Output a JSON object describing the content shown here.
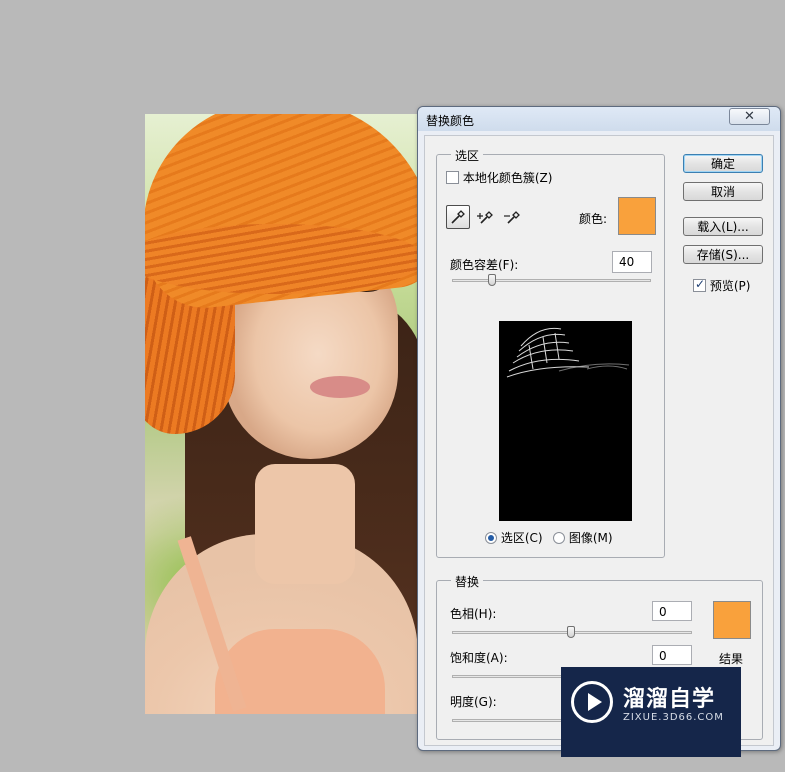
{
  "dialog": {
    "title": "替换颜色",
    "close_symbol": "✕",
    "selection_group": {
      "label": "选区",
      "localized_color_clusters": "本地化颜色簇(Z)",
      "localized_color_clusters_checked": false,
      "color_label": "颜色:",
      "selected_color": "#f9a13c",
      "fuzziness_label": "颜色容差(F):",
      "fuzziness_value": "40",
      "fuzziness_level": 0.2,
      "view_selection": "选区(C)",
      "view_image": "图像(M)",
      "view_mode": "selection"
    },
    "buttons": {
      "ok": "确定",
      "cancel": "取消",
      "load": "载入(L)...",
      "save": "存储(S)..."
    },
    "preview_label": "预览(P)",
    "preview_checked": true,
    "replacement_group": {
      "label": "替换",
      "hue_label": "色相(H):",
      "hue_value": "0",
      "saturation_label": "饱和度(A):",
      "saturation_value": "0",
      "lightness_label": "明度(G):",
      "result_label": "结果",
      "result_color": "#f9a13c"
    }
  },
  "watermark": {
    "title": "溜溜自学",
    "url": "ZIXUE.3D66.COM"
  }
}
